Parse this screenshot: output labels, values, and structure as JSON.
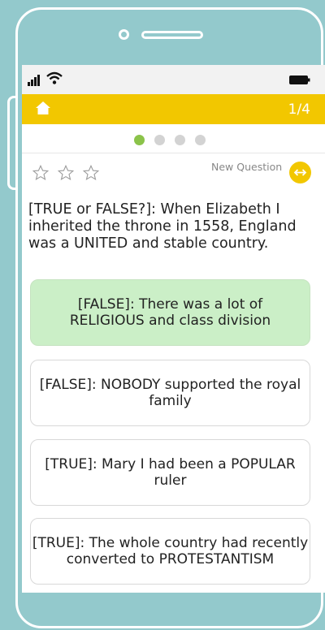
{
  "header": {
    "progress": "1/4"
  },
  "pager": {
    "total": 4,
    "active_index": 0
  },
  "rating": {
    "stars": 3,
    "filled": 0
  },
  "new_question_label": "New Question",
  "question": "[TRUE or FALSE?]: When Elizabeth I inherited the throne in 1558, England was a UNITED and stable country.",
  "answers": [
    {
      "text": "[FALSE]: There was a lot of RELIGIOUS and class division",
      "state": "correct"
    },
    {
      "text": "[FALSE]: NOBODY supported the royal family",
      "state": "default"
    },
    {
      "text": "[TRUE]: Mary I had been a POPULAR ruler",
      "state": "default"
    },
    {
      "text": "[TRUE]: The whole country had recently converted to PROTESTANTISM",
      "state": "default"
    }
  ],
  "colors": {
    "background": "#93c9cc",
    "accent": "#f2c700",
    "correct": "#cbefc7",
    "active_dot": "#8bc34a"
  },
  "icons": [
    "home-icon",
    "signal-icon",
    "wifi-icon",
    "battery-icon",
    "star-icon",
    "swap-arrows-icon"
  ]
}
